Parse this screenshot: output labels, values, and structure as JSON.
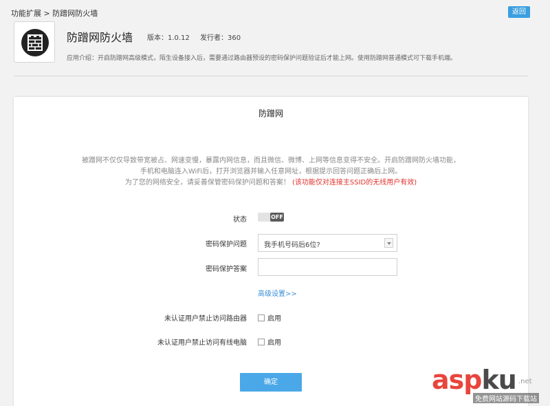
{
  "breadcrumb": "功能扩展 > 防蹭网防火墙",
  "back_label": "返回",
  "app": {
    "title": "防蹭网防火墙",
    "version": "版本：1.0.12",
    "publisher": "发行者：360",
    "description": "应用介绍：开启防蹭网高级模式，陌生设备接入后，需要通过路由器预设的密码保护问题验证后才能上网。使用防蹭网普通模式可下载手机端。"
  },
  "panel": {
    "title": "防蹭网",
    "intro_line1": "被蹭网不仅仅导致带宽被占、网速变慢，暴露内网信息，而且微信、微博、上网等信息变得不安全。开启防蹭网防火墙功能，",
    "intro_line2": "手机和电脑连入WiFi后，打开浏览器并输入任意网址，根据提示回答问题正确后上网。",
    "intro_line3": "为了您的网络安全，请妥善保管密码保护问题和答案！",
    "intro_warning": "(该功能仅对连接主SSID的无线用户有效)"
  },
  "form": {
    "status_label": "状态",
    "toggle_text": "OFF",
    "question_label": "密码保护问题",
    "question_value": "我手机号码后6位?",
    "answer_label": "密码保护答案",
    "answer_value": "",
    "advanced_link": "高级设置>>",
    "block_router_label": "未认证用户禁止访问路由器",
    "block_router_option": "启用",
    "block_wired_label": "未认证用户禁止访问有线电脑",
    "block_wired_option": "启用",
    "confirm_label": "确定"
  },
  "watermark": {
    "brand_a": "asp",
    "brand_b": "ku",
    "brand_suffix": ".net",
    "subtitle": "免费网站源码下载站"
  },
  "colors": {
    "accent": "#3a9fe0",
    "warning": "#e0302b"
  }
}
